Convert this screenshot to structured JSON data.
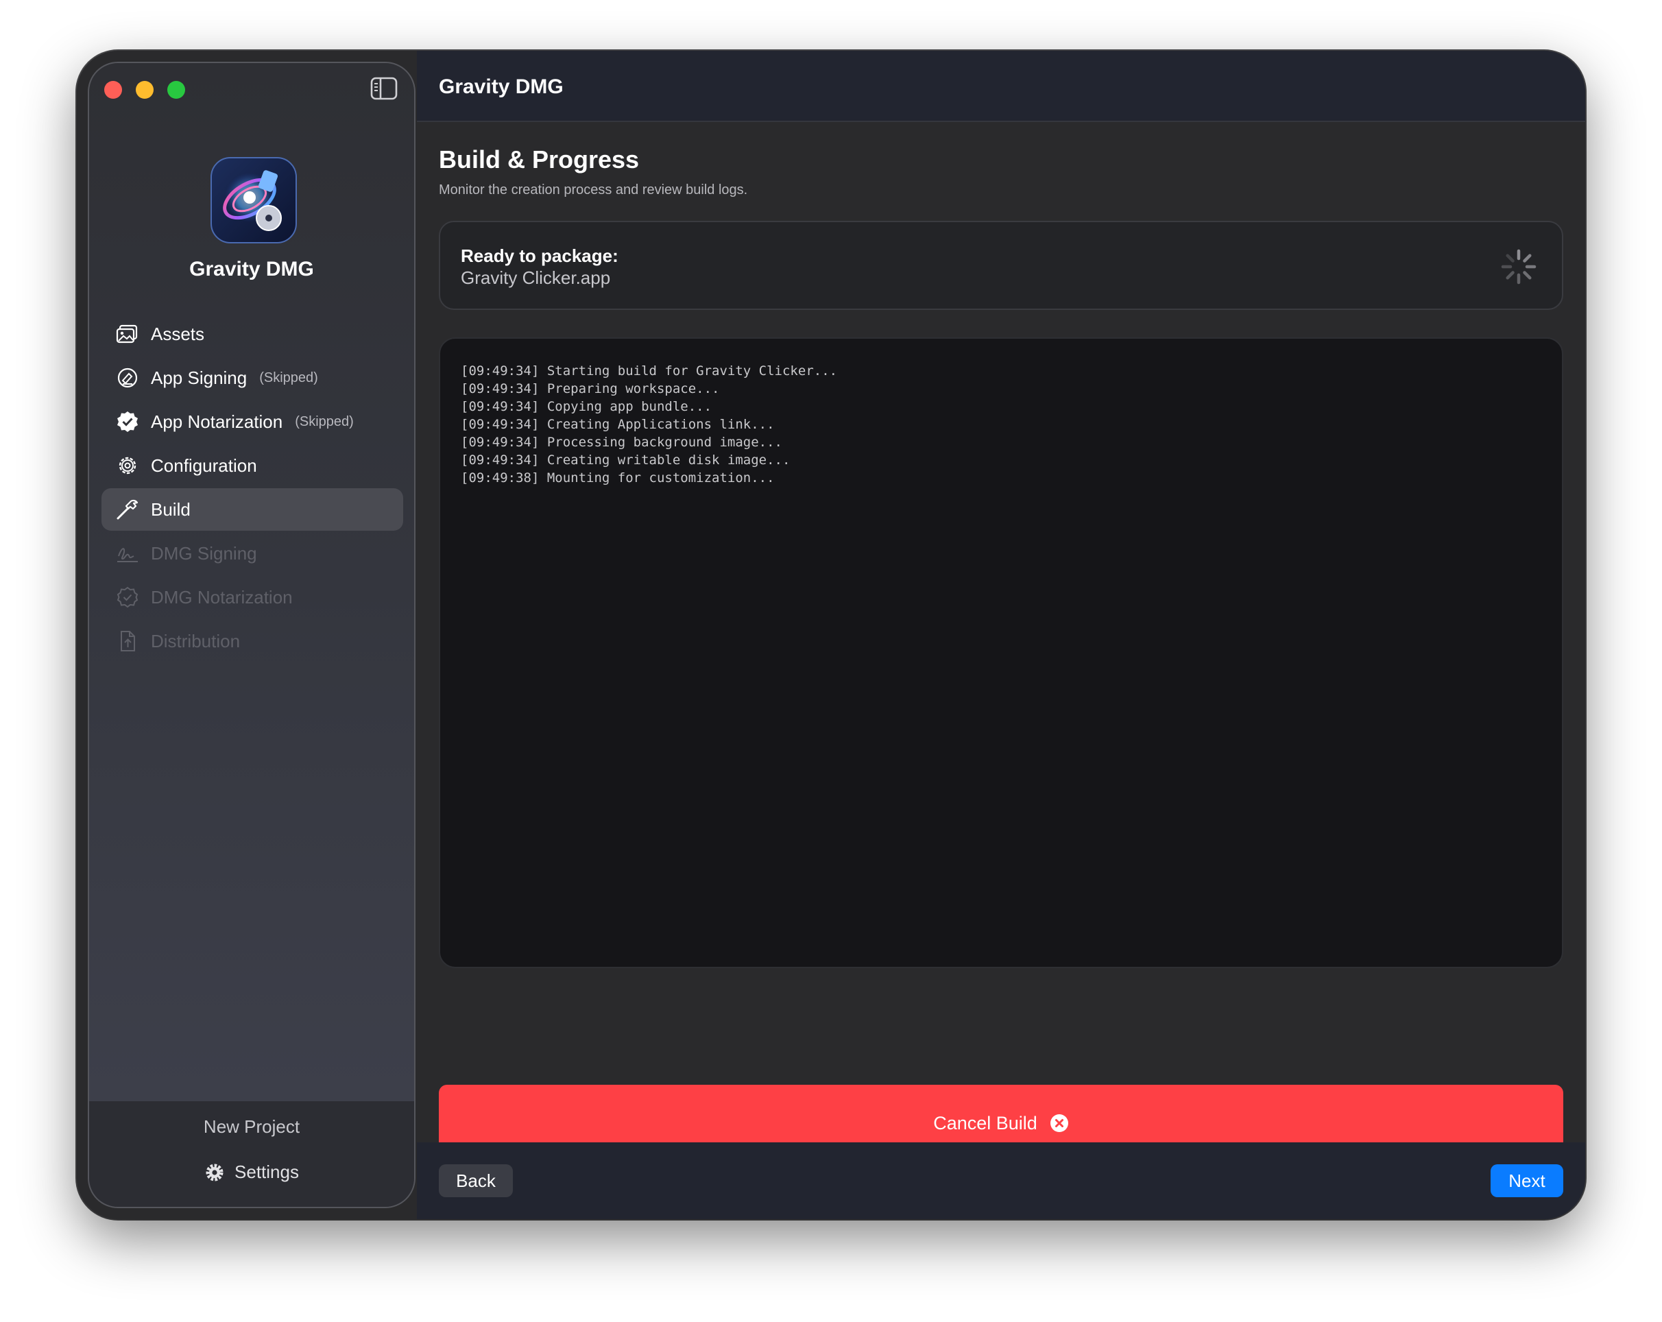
{
  "window": {
    "title": "Gravity DMG"
  },
  "sidebar": {
    "app_name": "Gravity DMG",
    "items": [
      {
        "label": "Assets",
        "icon": "photos-icon",
        "status": "",
        "state": "done"
      },
      {
        "label": "App Signing",
        "icon": "signature-icon",
        "status": "(Skipped)",
        "state": "done"
      },
      {
        "label": "App Notarization",
        "icon": "checkmark-seal-icon",
        "status": "(Skipped)",
        "state": "done"
      },
      {
        "label": "Configuration",
        "icon": "gear-icon",
        "status": "",
        "state": "done"
      },
      {
        "label": "Build",
        "icon": "hammer-icon",
        "status": "",
        "state": "active"
      },
      {
        "label": "DMG Signing",
        "icon": "signature-pen-icon",
        "status": "",
        "state": "disabled"
      },
      {
        "label": "DMG Notarization",
        "icon": "seal-icon",
        "status": "",
        "state": "disabled"
      },
      {
        "label": "Distribution",
        "icon": "document-upload-icon",
        "status": "",
        "state": "disabled"
      }
    ],
    "footer": {
      "new_project": "New Project",
      "settings": "Settings"
    }
  },
  "main": {
    "title": "Build & Progress",
    "subtitle": "Monitor the creation process and review build logs.",
    "status": {
      "label": "Ready to package:",
      "value": "Gravity Clicker.app"
    },
    "log": [
      "[09:49:34] Starting build for Gravity Clicker...",
      "[09:49:34] Preparing workspace...",
      "[09:49:34] Copying app bundle...",
      "[09:49:34] Creating Applications link...",
      "[09:49:34] Processing background image...",
      "[09:49:34] Creating writable disk image...",
      "[09:49:38] Mounting for customization..."
    ],
    "cancel_label": "Cancel Build"
  },
  "footer": {
    "back_label": "Back",
    "next_label": "Next"
  },
  "colors": {
    "accent": "#0a7cff",
    "danger": "#fe4045",
    "traffic_close": "#fe5f57",
    "traffic_min": "#febc2e",
    "traffic_max": "#28c840"
  }
}
